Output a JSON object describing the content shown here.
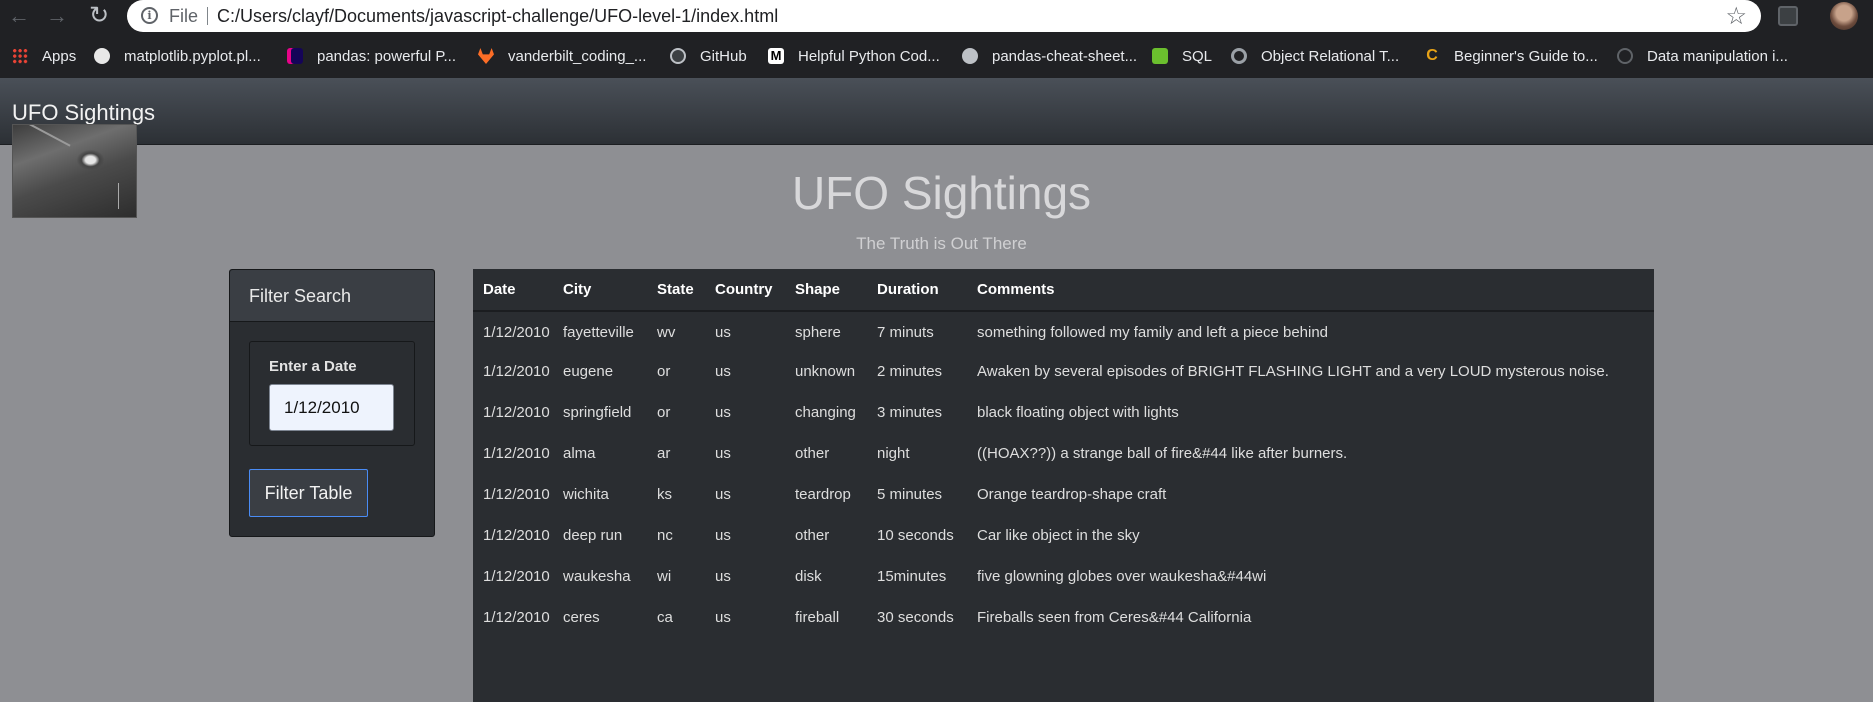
{
  "browser": {
    "scheme": "File",
    "url": "C:/Users/clayf/Documents/javascript-challenge/UFO-level-1/index.html",
    "bookmarks": [
      {
        "label": "Apps",
        "icon": "apps-icon"
      },
      {
        "label": "matplotlib.pyplot.pl...",
        "icon": "matplotlib-icon"
      },
      {
        "label": "pandas: powerful P...",
        "icon": "pandas-icon"
      },
      {
        "label": "vanderbilt_coding_...",
        "icon": "gitlab-icon"
      },
      {
        "label": "GitHub",
        "icon": "github-icon"
      },
      {
        "label": "Helpful Python Cod...",
        "icon": "medium-icon"
      },
      {
        "label": "pandas-cheat-sheet...",
        "icon": "globe-icon"
      },
      {
        "label": "SQL",
        "icon": "sql-icon"
      },
      {
        "label": "Object Relational T...",
        "icon": "orm-icon"
      },
      {
        "label": "Beginner's Guide to...",
        "icon": "guide-icon"
      },
      {
        "label": "Data manipulation i...",
        "icon": "data-icon"
      }
    ]
  },
  "navbar": {
    "brand": "UFO Sightings"
  },
  "hero": {
    "title": "UFO Sightings",
    "subtitle": "The Truth is Out There"
  },
  "filter": {
    "heading": "Filter Search",
    "label": "Enter a Date",
    "value": "1/12/2010",
    "button": "Filter Table"
  },
  "table": {
    "headers": [
      "Date",
      "City",
      "State",
      "Country",
      "Shape",
      "Duration",
      "Comments"
    ],
    "rows": [
      [
        "1/12/2010",
        "fayetteville",
        "wv",
        "us",
        "sphere",
        "7 minuts",
        "something followed my family and left a piece behind"
      ],
      [
        "1/12/2010",
        "eugene",
        "or",
        "us",
        "unknown",
        "2 minutes",
        "Awaken by several episodes of BRIGHT FLASHING LIGHT and a very LOUD mysterous noise."
      ],
      [
        "1/12/2010",
        "springfield",
        "or",
        "us",
        "changing",
        "3 minutes",
        "black floating object with lights"
      ],
      [
        "1/12/2010",
        "alma",
        "ar",
        "us",
        "other",
        "night",
        "((HOAX??)) a strange ball of fire&#44 like after burners."
      ],
      [
        "1/12/2010",
        "wichita",
        "ks",
        "us",
        "teardrop",
        "5 minutes",
        "Orange teardrop-shape craft"
      ],
      [
        "1/12/2010",
        "deep run",
        "nc",
        "us",
        "other",
        "10 seconds",
        "Car like object in the sky"
      ],
      [
        "1/12/2010",
        "waukesha",
        "wi",
        "us",
        "disk",
        "15minutes",
        "five glowning globes over waukesha&#44wi"
      ],
      [
        "1/12/2010",
        "ceres",
        "ca",
        "us",
        "fireball",
        "30 seconds",
        "Fireballs seen from Ceres&#44 California"
      ]
    ]
  }
}
